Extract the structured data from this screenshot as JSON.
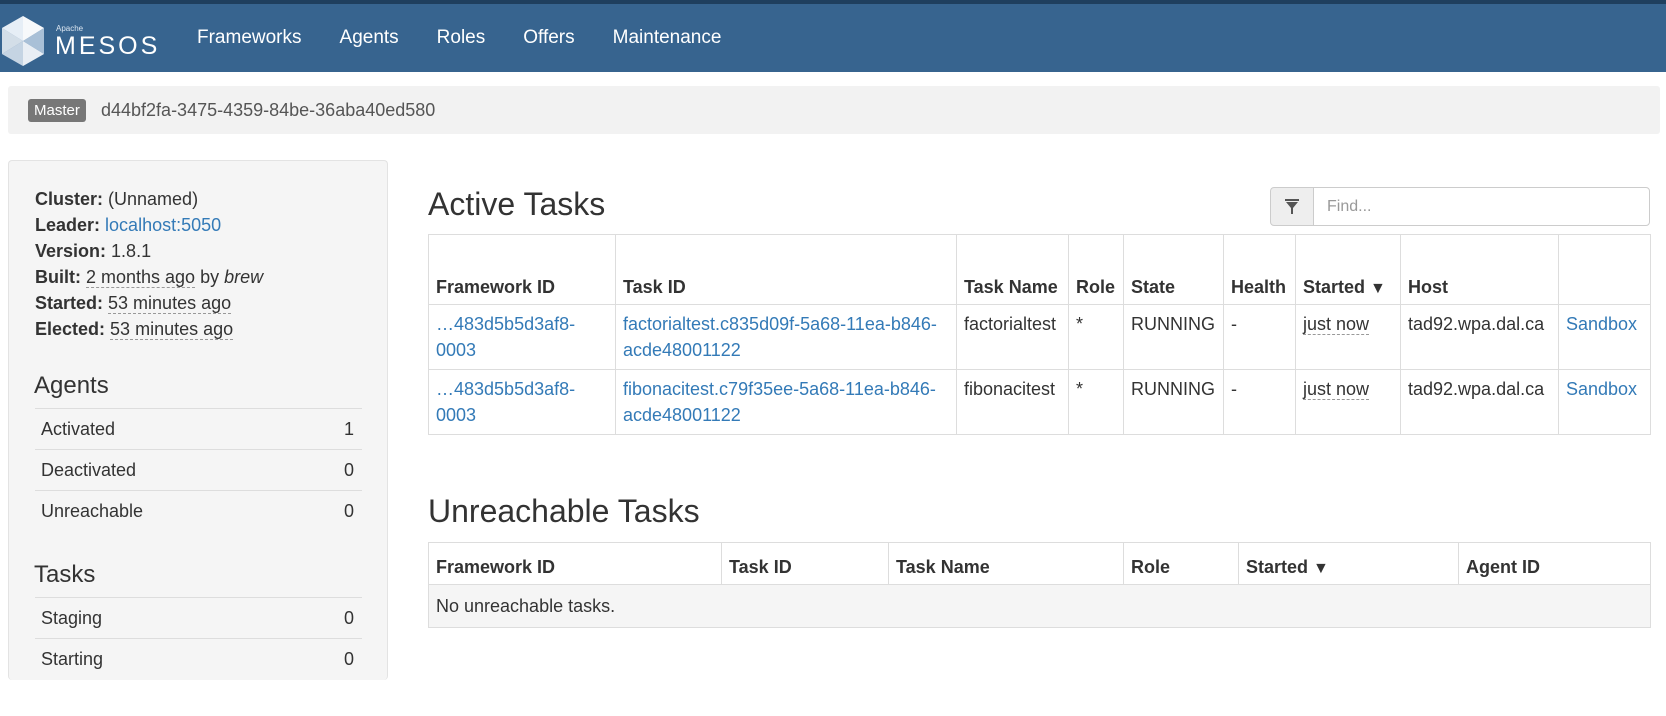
{
  "brand": {
    "apache": "Apache",
    "name": "MESOS"
  },
  "nav": [
    "Frameworks",
    "Agents",
    "Roles",
    "Offers",
    "Maintenance"
  ],
  "master": {
    "label": "Master",
    "id": "d44bf2fa-3475-4359-84be-36aba40ed580"
  },
  "cluster": {
    "cluster_label": "Cluster:",
    "cluster_value": "(Unnamed)",
    "leader_label": "Leader:",
    "leader_value": "localhost:5050",
    "version_label": "Version:",
    "version_value": "1.8.1",
    "built_label": "Built:",
    "built_ago": "2 months ago",
    "built_by": "by",
    "built_user": "brew",
    "started_label": "Started:",
    "started_value": "53 minutes ago",
    "elected_label": "Elected:",
    "elected_value": "53 minutes ago"
  },
  "agents": {
    "title": "Agents",
    "rows": [
      {
        "label": "Activated",
        "value": "1"
      },
      {
        "label": "Deactivated",
        "value": "0"
      },
      {
        "label": "Unreachable",
        "value": "0"
      }
    ]
  },
  "tasks": {
    "title": "Tasks",
    "rows": [
      {
        "label": "Staging",
        "value": "0"
      },
      {
        "label": "Starting",
        "value": "0"
      }
    ]
  },
  "active_tasks": {
    "title": "Active Tasks",
    "filter_placeholder": "Find...",
    "columns": [
      "Framework ID",
      "Task ID",
      "Task Name",
      "Role",
      "State",
      "Health",
      "Started",
      "Host",
      ""
    ],
    "sort_indicator": "▼",
    "rows": [
      {
        "framework_id": "…483d5b5d3af8-0003",
        "task_id": "factorialtest.c835d09f-5a68-11ea-b846-acde48001122",
        "task_name": "factorialtest",
        "role": "*",
        "state": "RUNNING",
        "health": "-",
        "started": "just now",
        "host": "tad92.wpa.dal.ca",
        "action": "Sandbox"
      },
      {
        "framework_id": "…483d5b5d3af8-0003",
        "task_id": "fibonacitest.c79f35ee-5a68-11ea-b846-acde48001122",
        "task_name": "fibonacitest",
        "role": "*",
        "state": "RUNNING",
        "health": "-",
        "started": "just now",
        "host": "tad92.wpa.dal.ca",
        "action": "Sandbox"
      }
    ]
  },
  "unreachable_tasks": {
    "title": "Unreachable Tasks",
    "columns": [
      "Framework ID",
      "Task ID",
      "Task Name",
      "Role",
      "Started",
      "Agent ID"
    ],
    "sort_indicator": "▼",
    "empty_message": "No unreachable tasks."
  },
  "colors": {
    "navbar": "#37648f",
    "link": "#337ab7"
  },
  "icons": {
    "logo": "mesos-hex-logo",
    "filter": "filter-icon"
  }
}
